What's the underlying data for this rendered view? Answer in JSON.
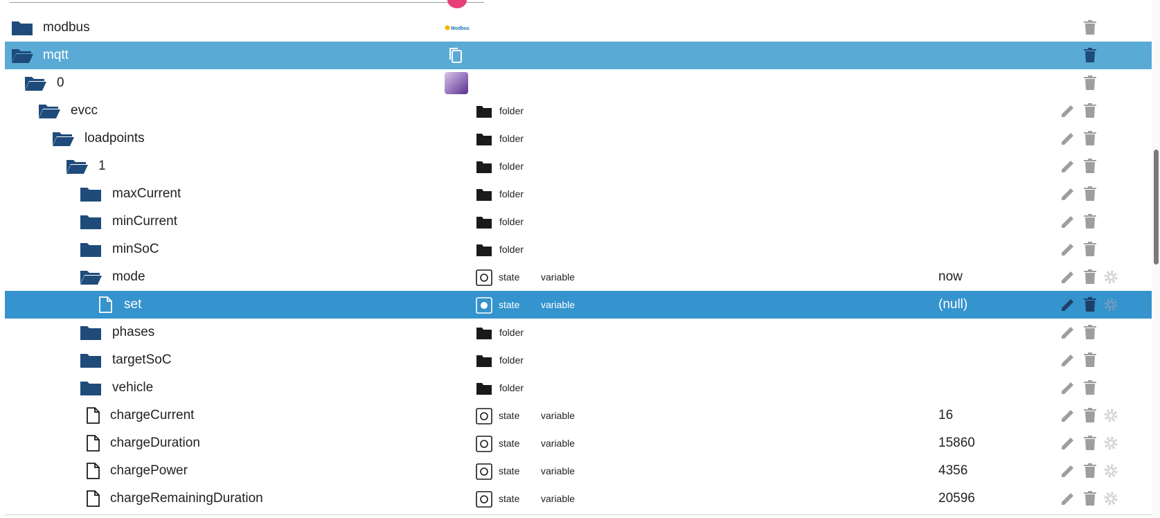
{
  "rows": [
    {
      "name": "modbus",
      "type": "",
      "role": "",
      "value": ""
    },
    {
      "name": "mqtt",
      "type": "",
      "role": "",
      "value": ""
    },
    {
      "name": "0",
      "type": "",
      "role": "",
      "value": ""
    },
    {
      "name": "evcc",
      "type": "folder",
      "role": "",
      "value": ""
    },
    {
      "name": "loadpoints",
      "type": "folder",
      "role": "",
      "value": ""
    },
    {
      "name": "1",
      "type": "folder",
      "role": "",
      "value": ""
    },
    {
      "name": "maxCurrent",
      "type": "folder",
      "role": "",
      "value": ""
    },
    {
      "name": "minCurrent",
      "type": "folder",
      "role": "",
      "value": ""
    },
    {
      "name": "minSoC",
      "type": "folder",
      "role": "",
      "value": ""
    },
    {
      "name": "mode",
      "type": "state",
      "role": "variable",
      "value": "now"
    },
    {
      "name": "set",
      "type": "state",
      "role": "variable",
      "value": "(null)"
    },
    {
      "name": "phases",
      "type": "folder",
      "role": "",
      "value": ""
    },
    {
      "name": "targetSoC",
      "type": "folder",
      "role": "",
      "value": ""
    },
    {
      "name": "vehicle",
      "type": "folder",
      "role": "",
      "value": ""
    },
    {
      "name": "chargeCurrent",
      "type": "state",
      "role": "variable",
      "value": "16"
    },
    {
      "name": "chargeDuration",
      "type": "state",
      "role": "variable",
      "value": "15860"
    },
    {
      "name": "chargePower",
      "type": "state",
      "role": "variable",
      "value": "4356"
    },
    {
      "name": "chargeRemainingDuration",
      "type": "state",
      "role": "variable",
      "value": "20596"
    }
  ],
  "modbus_logo_text": "Modbus",
  "icons": {
    "folder_closed": "folder-closed-icon",
    "folder_open": "folder-open-icon",
    "file": "file-icon",
    "state": "state-icon",
    "edit": "pencil-icon",
    "delete": "trash-icon",
    "settings": "gear-icon",
    "copy": "copy-icon"
  },
  "colors": {
    "folder": "#1e4b7a",
    "selected_parent": "#5aaad6",
    "selected_row": "#3593cd",
    "action_icon": "#9e9e9e"
  }
}
